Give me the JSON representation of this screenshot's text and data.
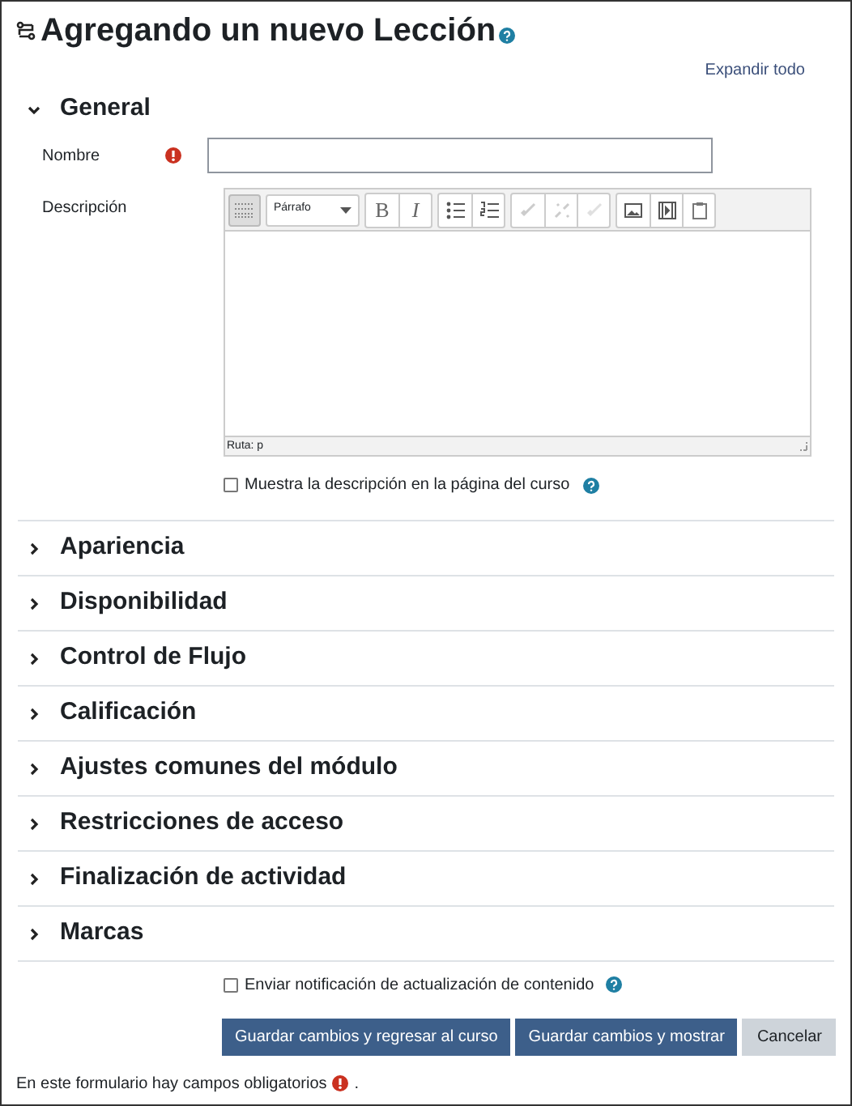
{
  "title": "Agregando un nuevo Lección",
  "expand_all": "Expandir todo",
  "sections": [
    {
      "title": "General",
      "expanded": true
    },
    {
      "title": "Apariencia",
      "expanded": false
    },
    {
      "title": "Disponibilidad",
      "expanded": false
    },
    {
      "title": "Control de Flujo",
      "expanded": false
    },
    {
      "title": "Calificación",
      "expanded": false
    },
    {
      "title": "Ajustes comunes del módulo",
      "expanded": false
    },
    {
      "title": "Restricciones de acceso",
      "expanded": false
    },
    {
      "title": "Finalización de actividad",
      "expanded": false
    },
    {
      "title": "Marcas",
      "expanded": false
    }
  ],
  "general": {
    "name_label": "Nombre",
    "description_label": "Descripción",
    "format_select": "Párrafo",
    "bold_button": "B",
    "italic_button": "I",
    "path": "Ruta: p",
    "show_description": {
      "label": "Muestra la descripción en la página del curso",
      "checked": false
    }
  },
  "notify": {
    "label": "Enviar notificación de actualización de contenido",
    "checked": false
  },
  "buttons": [
    {
      "label": "Guardar cambios y regresar al curso",
      "kind": "primary"
    },
    {
      "label": "Guardar cambios y mostrar",
      "kind": "primary"
    },
    {
      "label": "Cancelar",
      "kind": "secondary"
    }
  ],
  "footer": "En este formulario hay campos obligatorios",
  "footer_period": "."
}
